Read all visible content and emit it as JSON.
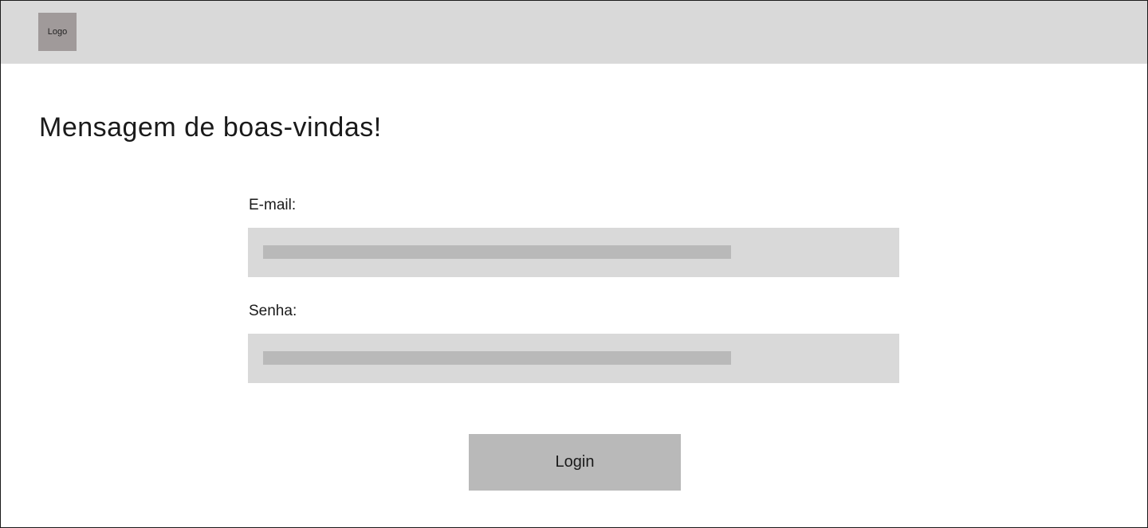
{
  "header": {
    "logo_text": "Logo",
    "background_color": "#d9d9d9",
    "logo_color": "#a09a9a"
  },
  "main": {
    "welcome_title": "Mensagem de boas-vindas!"
  },
  "form": {
    "email": {
      "label": "E-mail:",
      "value": "",
      "placeholder": ""
    },
    "password": {
      "label": "Senha:",
      "value": "",
      "placeholder": ""
    },
    "login_label": "Login"
  },
  "colors": {
    "input_background": "#d9d9d9",
    "input_placeholder_bar": "#b9b9b9",
    "button_background": "#b9b9b9",
    "text": "#1a1a1a"
  }
}
